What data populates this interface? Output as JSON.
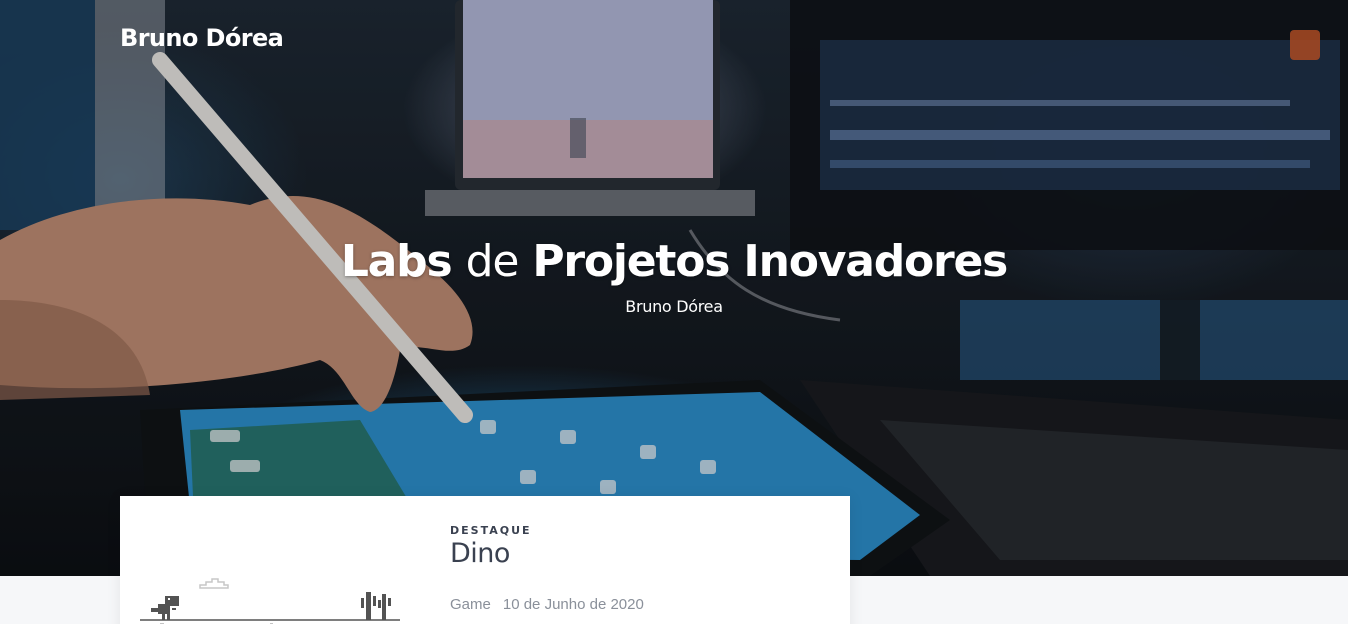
{
  "site": {
    "brand": "Bruno Dórea"
  },
  "hero": {
    "title_part1": "Labs",
    "title_part2": "de",
    "title_part3": "Projetos Inovadores",
    "subtitle": "Bruno Dórea"
  },
  "featured": {
    "eyebrow": "DESTAQUE",
    "title": "Dino",
    "category": "Game",
    "date": "10 de Junho de 2020",
    "thumbnail_icon": "dino-game-icon"
  },
  "colors": {
    "text_dark": "#3a4150",
    "meta": "#8a909a",
    "hero_text": "#ffffff"
  }
}
